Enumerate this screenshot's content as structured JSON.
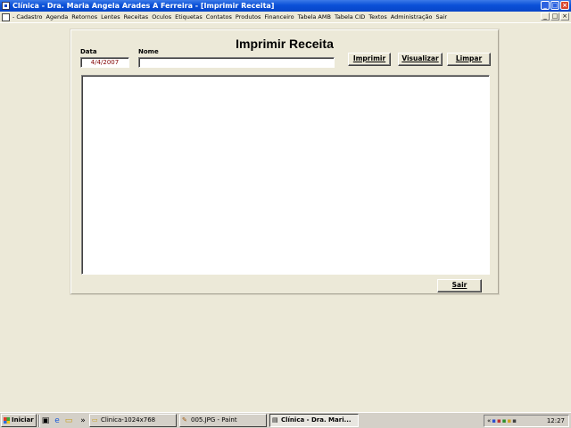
{
  "window": {
    "title": "Clínica - Dra. Maria Angela Arades A Ferreira - [Imprimir Receita]",
    "controls": [
      "_",
      "□",
      "×"
    ]
  },
  "menu": {
    "items": [
      "- Cadastro",
      "Agenda",
      "Retornos",
      "Lentes",
      "Receitas",
      "Oculos",
      "Etiquetas",
      "Contatos",
      "Produtos",
      "Financeiro",
      "Tabela AMB",
      "Tabela CID",
      "Textos",
      "Administração",
      "Sair"
    ],
    "mdi_controls": [
      "_",
      "□",
      "×"
    ]
  },
  "form": {
    "title": "Imprimir Receita",
    "data_label": "Data",
    "data_value": "4/4/2007",
    "nome_label": "Nome",
    "nome_value": "",
    "buttons": {
      "imprimir": "Imprimir",
      "visualizar": "Visualizar",
      "limpar": "Limpar",
      "sair": "Sair"
    }
  },
  "taskbar": {
    "start_label": "Iniciar",
    "tasks": [
      {
        "label": "Clinica-1024x768",
        "icon": "folder-icon"
      },
      {
        "label": "005.JPG - Paint",
        "icon": "paint-icon"
      },
      {
        "label": "Clínica - Dra. Mari...",
        "icon": "app-window-icon",
        "active": true
      }
    ],
    "clock": "12:27"
  }
}
